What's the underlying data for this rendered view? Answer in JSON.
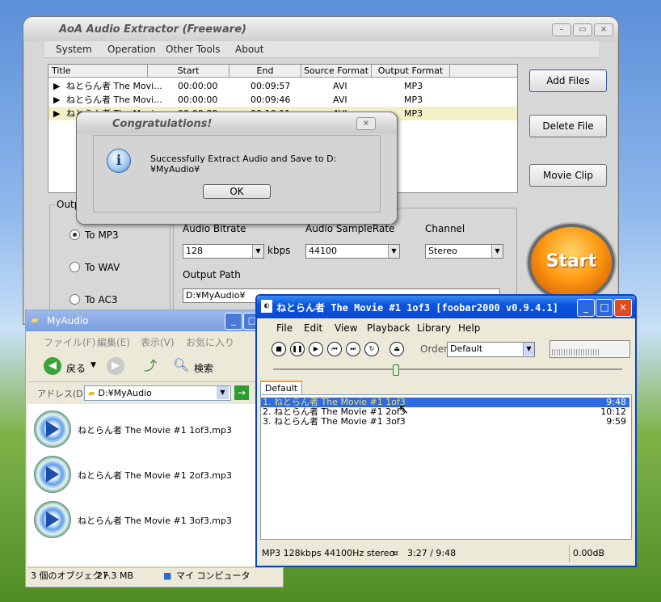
{
  "aoa": {
    "title": "AoA Audio Extractor (Freeware)",
    "menu": [
      "System",
      "Operation",
      "Other Tools",
      "About"
    ],
    "columns": [
      "Title",
      "Start",
      "End",
      "Source Format",
      "Output Format"
    ],
    "rows": [
      {
        "title": "ねとらん者 The Movi...",
        "start": "00:00:00",
        "end": "00:09:57",
        "src": "AVI",
        "out": "MP3"
      },
      {
        "title": "ねとらん者 The Movi...",
        "start": "00:00:00",
        "end": "00:09:46",
        "src": "AVI",
        "out": "MP3"
      },
      {
        "title": "ねとらん者 The Movi...",
        "start": "00:00:00",
        "end": "00:10:11",
        "src": "AVI",
        "out": "MP3"
      }
    ],
    "buttons": {
      "add": "Add Files",
      "delete": "Delete File",
      "clip": "Movie Clip",
      "start": "Start"
    },
    "output_group": "Outp",
    "formats": [
      "To MP3",
      "To WAV",
      "To AC3"
    ],
    "bitrate_label": "Audio Bitrate",
    "bitrate_value": "128",
    "kbps": "kbps",
    "samplerate_label": "Audio SampleRate",
    "samplerate_value": "44100",
    "channel_label": "Channel",
    "channel_value": "Stereo",
    "outpath_label": "Output Path",
    "outpath_value": "D:¥MyAudio¥"
  },
  "dialog": {
    "title": "Congratulations!",
    "message": "Successfully Extract Audio and Save to D:¥MyAudio¥",
    "ok": "OK",
    "close": "×"
  },
  "explorer": {
    "title": "MyAudio",
    "menu": [
      "ファイル(F)",
      "編集(E)",
      "表示(V)",
      "お気に入り"
    ],
    "back": "戻る",
    "search": "検索",
    "address_label": "アドレス(D)",
    "address_value": "D:¥MyAudio",
    "files": [
      "ねとらん者 The Movie #1 1of3.mp3",
      "ねとらん者 The Movie #1 2of3.mp3",
      "ねとらん者 The Movie #1 3of3.mp3"
    ],
    "status_count": "3 個のオブジェクト",
    "status_size": "27.3 MB",
    "status_location": "マイ コンピュータ"
  },
  "foobar": {
    "title": "ねとらん者 The Movie #1 1of3   [foobar2000 v0.9.4.1]",
    "menu": [
      "File",
      "Edit",
      "View",
      "Playback",
      "Library",
      "Help"
    ],
    "order_label": "Order",
    "order_value": "Default",
    "tab": "Default",
    "playlist": [
      {
        "name": "1. ねとらん者 The Movie #1 1of3",
        "time": "9:48"
      },
      {
        "name": "2. ねとらん者 The Movie #1 2of3",
        "time": "10:12"
      },
      {
        "name": "3. ねとらん者 The Movie #1 3of3",
        "time": "9:59"
      }
    ],
    "status_info": "MP3 128kbps 44100Hz stereo",
    "status_pos": "3:27 / 9:48",
    "status_gain": "0.00dB",
    "seek_fraction": 0.35
  }
}
